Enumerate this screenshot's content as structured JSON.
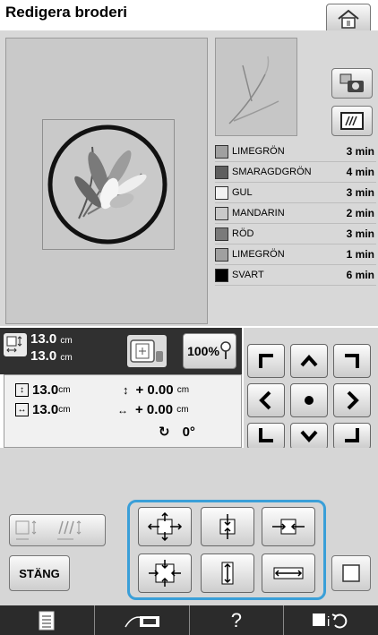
{
  "header": {
    "title": "Redigera broderi",
    "home_icon": "home-icon"
  },
  "thread_colors": [
    {
      "name": "LIMEGRÖN",
      "time": "3 min",
      "color": "#a0a0a0"
    },
    {
      "name": "SMARAGDGRÖN",
      "time": "4 min",
      "color": "#5e5e5e"
    },
    {
      "name": "GUL",
      "time": "3 min",
      "color": "#f2f2f2"
    },
    {
      "name": "MANDARIN",
      "time": "2 min",
      "color": "#c9c9c9"
    },
    {
      "name": "RÖD",
      "time": "3 min",
      "color": "#7a7a7a"
    },
    {
      "name": "LIMEGRÖN",
      "time": "1 min",
      "color": "#a0a0a0"
    },
    {
      "name": "SVART",
      "time": "6 min",
      "color": "#000000"
    }
  ],
  "size_bar": {
    "height": "13.0",
    "width": "13.0",
    "unit": "cm",
    "zoom": "100%"
  },
  "info": {
    "height_value": "13.0",
    "height_unit": "cm",
    "width_value": "13.0",
    "width_unit": "cm",
    "v_offset": "+ 0.00",
    "v_offset_unit": "cm",
    "h_offset": "+ 0.00",
    "h_offset_unit": "cm",
    "rotation": "0°"
  },
  "buttons": {
    "close_label": "STÄNG",
    "help_label": "?"
  }
}
